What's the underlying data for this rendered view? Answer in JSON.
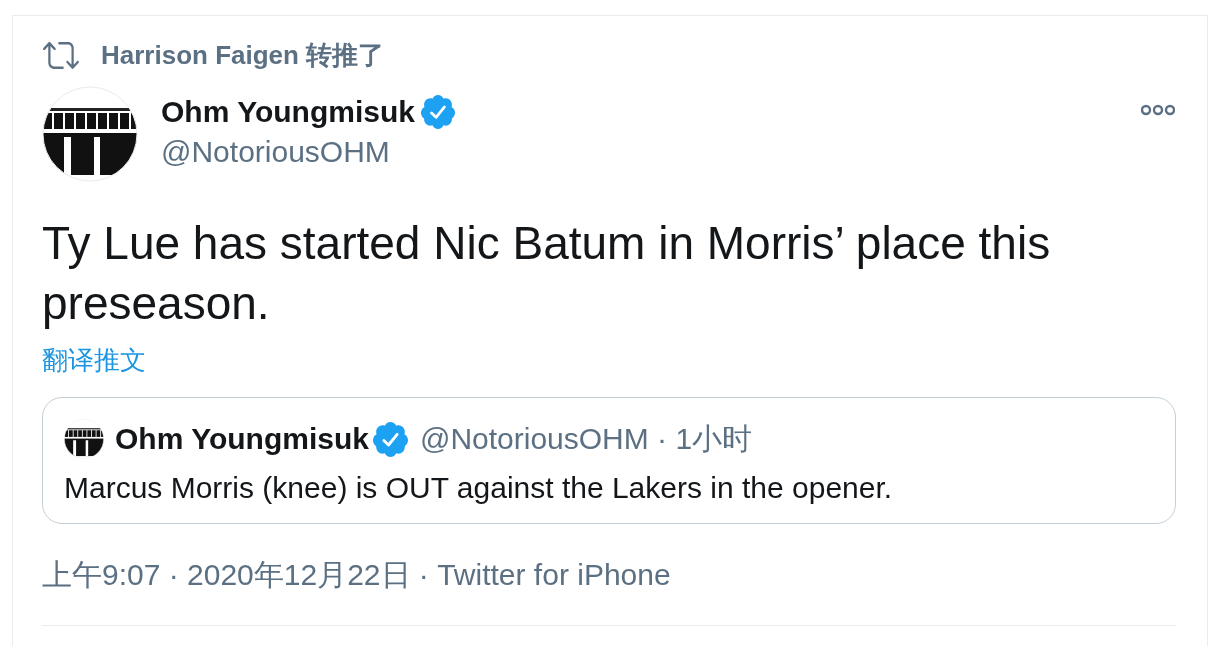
{
  "retweet_banner": {
    "text": "Harrison Faigen 转推了"
  },
  "tweet": {
    "author": {
      "name": "Ohm Youngmisuk",
      "verified": true,
      "handle": "@NotoriousOHM"
    },
    "text": "Ty Lue has started Nic Batum in Morris’ place this preseason.",
    "translate_link": "翻译推文",
    "quoted_tweet": {
      "author": {
        "name": "Ohm Youngmisuk",
        "verified": true,
        "byline": "@NotoriousOHM · 1小时"
      },
      "text": "Marcus Morris (knee) is OUT against the Lakers in the opener."
    },
    "footer": "上午9:07 · 2020年12月22日 · Twitter for iPhone"
  }
}
